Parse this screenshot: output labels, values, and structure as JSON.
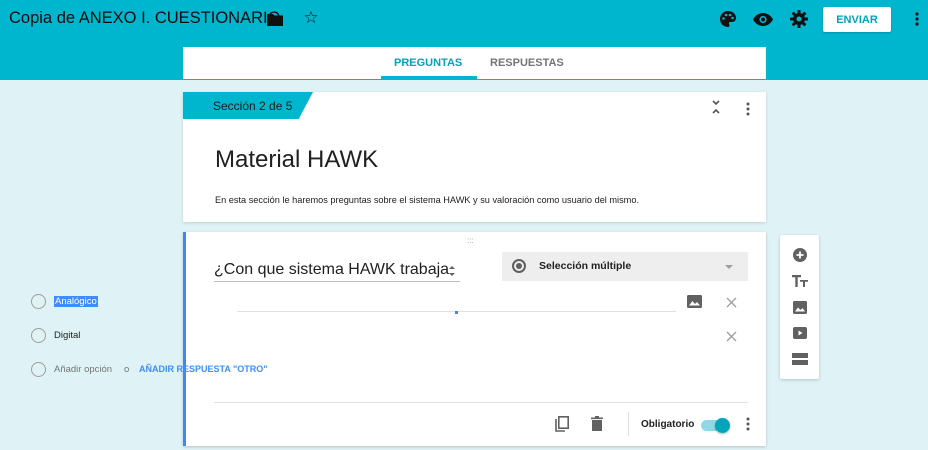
{
  "header": {
    "title": "Copia de ANEXO I. CUESTIONARIO",
    "send_label": "ENVIAR",
    "icons": [
      "folder-icon",
      "star-icon",
      "palette-icon",
      "eye-icon",
      "gear-icon",
      "more-vert-icon"
    ]
  },
  "tabs": [
    {
      "label": "PREGUNTAS",
      "active": true
    },
    {
      "label": "RESPUESTAS",
      "active": false
    }
  ],
  "section": {
    "badge": "Sección 2 de 5",
    "title": "Material HAWK",
    "description": "En esta sección le haremos preguntas sobre el sistema HAWK y su  valoración como usuario del mismo."
  },
  "question": {
    "drag_handle": ":::",
    "title": "¿Con que sistema HAWK trabaja",
    "type_label": "Selección múltiple",
    "options": [
      {
        "label": "Analógico",
        "selected_text": true
      },
      {
        "label": "Digital"
      }
    ],
    "add_option": {
      "placeholder": "Añadir opción",
      "or": "o",
      "add_other": "AÑADIR RESPUESTA \"OTRO\""
    },
    "required_label": "Obligatorio",
    "required": true
  },
  "colors": {
    "header": "#00b6cf",
    "background": "#dff3f6",
    "accent": "#00a4bb",
    "active_bar": "#4285f4",
    "link": "#3e8dff"
  },
  "side_toolbar": [
    "add-circle-icon",
    "title-text-icon",
    "image-icon",
    "video-icon",
    "section-icon"
  ]
}
